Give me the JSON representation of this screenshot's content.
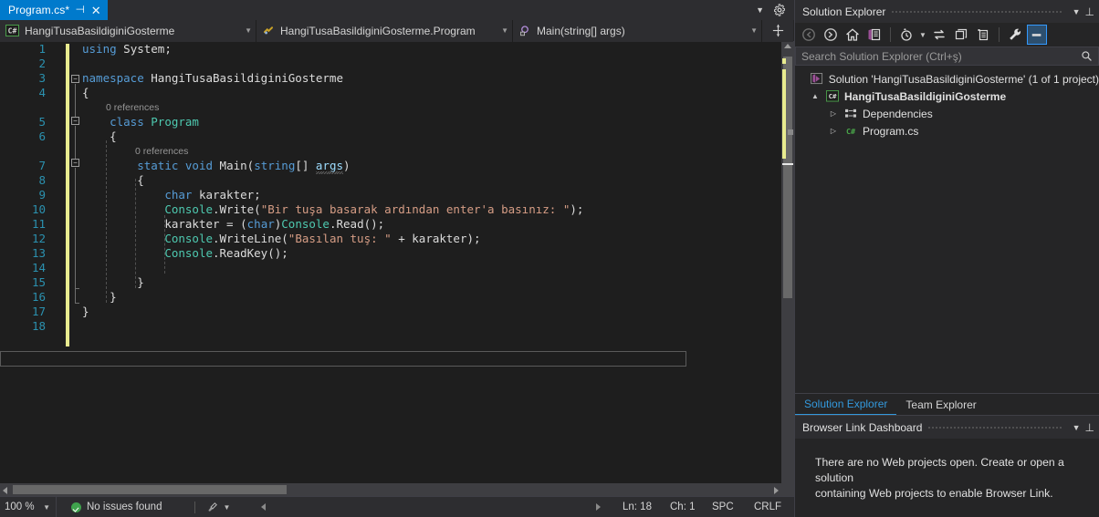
{
  "editor": {
    "tab": {
      "label": "Program.cs*",
      "pin_icon": "pin-icon",
      "close_icon": "close-icon"
    },
    "navbar": {
      "project": "HangiTusaBasildiginiGosterme",
      "type": "HangiTusaBasildiginiGosterme.Program",
      "member": "Main(string[] args)"
    },
    "line_numbers": [
      "1",
      "2",
      "3",
      "4",
      "5",
      "6",
      "7",
      "8",
      "9",
      "10",
      "11",
      "12",
      "13",
      "14",
      "15",
      "16",
      "17",
      "18"
    ],
    "codelens": {
      "class_refs": "0 references",
      "method_refs": "0 references"
    },
    "code_lines": [
      "using System;",
      "",
      "namespace HangiTusaBasildiginiGosterme",
      "{",
      "    class Program",
      "    {",
      "        static void Main(string[] args)",
      "        {",
      "            char karakter;",
      "            Console.Write(\"Bir tuşa basarak ardından enter'a basınız: \");",
      "            karakter = (char)Console.Read();",
      "            Console.WriteLine(\"Basılan tuş: \" + karakter);",
      "            Console.ReadKey();",
      "",
      "        }",
      "    }",
      "}",
      ""
    ]
  },
  "statusbar": {
    "zoom": "100 %",
    "issues": "No issues found",
    "issues_icon": "check-circle-icon",
    "brush_icon": "brush-icon",
    "ln": "Ln: 18",
    "ch": "Ch: 1",
    "spc": "SPC",
    "eol": "CRLF"
  },
  "solution_explorer": {
    "title": "Solution Explorer",
    "toolbar": [
      {
        "name": "back-icon",
        "glyph": "back"
      },
      {
        "name": "forward-icon",
        "glyph": "forward"
      },
      {
        "name": "home-icon",
        "glyph": "home"
      },
      {
        "name": "solution-overview-icon",
        "glyph": "overview"
      },
      {
        "name": "pending-changes-icon",
        "glyph": "clock"
      },
      {
        "name": "sync-with-active-document-icon",
        "glyph": "sync"
      },
      {
        "name": "refresh-icon",
        "glyph": "refresh"
      },
      {
        "name": "collapse-all-icon",
        "glyph": "collapse"
      },
      {
        "name": "properties-icon",
        "glyph": "wrench"
      },
      {
        "name": "preview-selected-items-icon",
        "glyph": "preview"
      }
    ],
    "search_placeholder": "Search Solution Explorer (Ctrl+ş)",
    "search_icon": "search-icon",
    "tree": [
      {
        "label": "Solution 'HangiTusaBasildiginiGosterme' (1 of 1 project)",
        "icon": "solution-icon",
        "level": 0,
        "twisty": "",
        "bold": false
      },
      {
        "label": "HangiTusaBasildiginiGosterme",
        "icon": "csharp-project-icon",
        "level": 1,
        "twisty": "▲",
        "bold": true
      },
      {
        "label": "Dependencies",
        "icon": "dependencies-icon",
        "level": 2,
        "twisty": "▷",
        "bold": false
      },
      {
        "label": "Program.cs",
        "icon": "csharp-file-icon",
        "level": 2,
        "twisty": "▷",
        "bold": false
      }
    ],
    "tabs": [
      {
        "label": "Solution Explorer",
        "active": true
      },
      {
        "label": "Team Explorer",
        "active": false
      }
    ]
  },
  "browser_link": {
    "title": "Browser Link Dashboard",
    "message_line1": "There are no Web projects open. Create or open a solution",
    "message_line2": "containing Web projects to enable Browser Link."
  },
  "colors": {
    "accent": "#007ACC",
    "editor_bg": "#1e1e1e",
    "chrome_bg": "#2d2d30",
    "panel_bg": "#252526",
    "changebar": "#e8eb8f",
    "keyword": "#569cd6",
    "type": "#4EC9B0",
    "string": "#d69d85",
    "linenum": "#2b91af",
    "codelens": "#969696"
  }
}
